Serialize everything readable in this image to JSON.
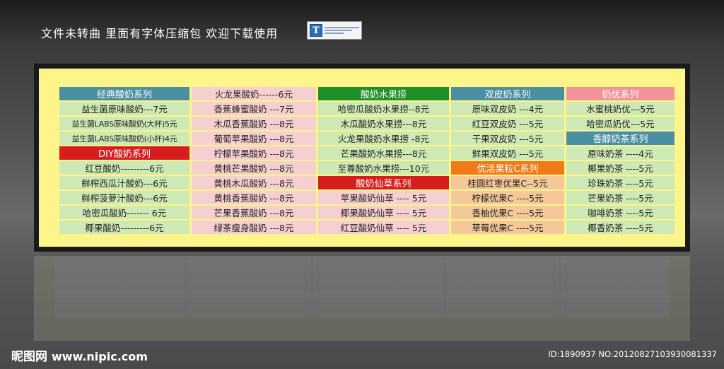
{
  "header_note": "文件未转曲  里面有字体压缩包  欢迎下载使用",
  "font_icon": "truetype-font-file-icon",
  "columns": [
    {
      "rows": [
        {
          "text": "经典酸奶系列",
          "kind": "hdr-teal"
        },
        {
          "text": "益生菌原味酸奶---7元",
          "kind": "g"
        },
        {
          "text": "益生菌LABS原味酸奶(大杯)5元",
          "kind": "g small"
        },
        {
          "text": "益生菌LABS原味酸奶(小杯)4元",
          "kind": "g small"
        },
        {
          "text": "DIY酸奶系列",
          "kind": "hdr-red"
        },
        {
          "text": "红豆酸奶---------6元",
          "kind": "g"
        },
        {
          "text": "鲜榨西瓜汁酸奶---6元",
          "kind": "g"
        },
        {
          "text": "鲜榨菠萝汁酸奶---6元",
          "kind": "g"
        },
        {
          "text": "哈密瓜酸奶------- 6元",
          "kind": "g"
        },
        {
          "text": "椰果酸奶---------6元",
          "kind": "g"
        }
      ]
    },
    {
      "rows": [
        {
          "text": "火龙果酸奶------6元",
          "kind": "p"
        },
        {
          "text": "香蕉蜂蜜酸奶 ---7元",
          "kind": "p"
        },
        {
          "text": "木瓜香蕉酸奶 ---8元",
          "kind": "p"
        },
        {
          "text": "葡萄苹果酸奶 ---8元",
          "kind": "p"
        },
        {
          "text": "柠檬苹果酸奶 ---8元",
          "kind": "p"
        },
        {
          "text": "黄桃芒果酸奶 ---8元",
          "kind": "p"
        },
        {
          "text": "黄桃木瓜酸奶 ---8元",
          "kind": "p"
        },
        {
          "text": "黄桃香蕉酸奶 ---8元",
          "kind": "p"
        },
        {
          "text": "芒果香蕉酸奶 ---8元",
          "kind": "p"
        },
        {
          "text": "绿茶瘦身酸奶 ---8元",
          "kind": "p"
        }
      ]
    },
    {
      "rows": [
        {
          "text": "酸奶水果捞",
          "kind": "hdr-green"
        },
        {
          "text": "哈密瓜酸奶水果捞--8元",
          "kind": "g"
        },
        {
          "text": "木瓜酸奶水果捞---8元",
          "kind": "g"
        },
        {
          "text": "火龙果酸奶水果捞 -8元",
          "kind": "g"
        },
        {
          "text": "芒果酸奶水果捞---8元",
          "kind": "g"
        },
        {
          "text": "至尊酸奶水果捞---10元",
          "kind": "g"
        },
        {
          "text": "酸奶仙草系列",
          "kind": "hdr-red"
        },
        {
          "text": "苹果酸奶仙草 ---- 5元",
          "kind": "p"
        },
        {
          "text": "椰果酸奶仙草 ---- 5元",
          "kind": "p"
        },
        {
          "text": "红豆酸奶仙草 ---- 5元",
          "kind": "p"
        }
      ]
    },
    {
      "rows": [
        {
          "text": "双皮奶系列",
          "kind": "hdr-teal"
        },
        {
          "text": "原味双皮奶 ---4元",
          "kind": "g"
        },
        {
          "text": "红豆双皮奶 ---5元",
          "kind": "g"
        },
        {
          "text": "干果双皮奶 ---5元",
          "kind": "g"
        },
        {
          "text": "鲜果双皮奶 ---5元",
          "kind": "g"
        },
        {
          "text": "优活果粒C系列",
          "kind": "hdr-orange"
        },
        {
          "text": "桂圆红枣优果C--5元",
          "kind": "o"
        },
        {
          "text": "柠檬优果C ----5元",
          "kind": "o"
        },
        {
          "text": "香柚优果C ----5元",
          "kind": "o"
        },
        {
          "text": "草莓优果C ----5元",
          "kind": "o"
        }
      ]
    },
    {
      "rows": [
        {
          "text": "奶优系列",
          "kind": "hdr-pink"
        },
        {
          "text": "水蜜桃奶优---5元",
          "kind": "g"
        },
        {
          "text": "哈密瓜奶优---5元",
          "kind": "g"
        },
        {
          "text": "香醇奶茶系列",
          "kind": "hdr-teal"
        },
        {
          "text": "原味奶茶 ----4元",
          "kind": "g"
        },
        {
          "text": "椰果奶茶 ----5元",
          "kind": "g"
        },
        {
          "text": "珍珠奶茶 ----5元",
          "kind": "g"
        },
        {
          "text": "芒果奶茶 ----5元",
          "kind": "g"
        },
        {
          "text": "咖啡奶茶 ----5元",
          "kind": "g"
        },
        {
          "text": "椰香奶茶 ----5元",
          "kind": "g"
        }
      ]
    }
  ],
  "watermark_logo": "昵图网",
  "watermark_url": "www.nipic.com",
  "image_id": "ID:1890937 NO:20120827103930081337"
}
